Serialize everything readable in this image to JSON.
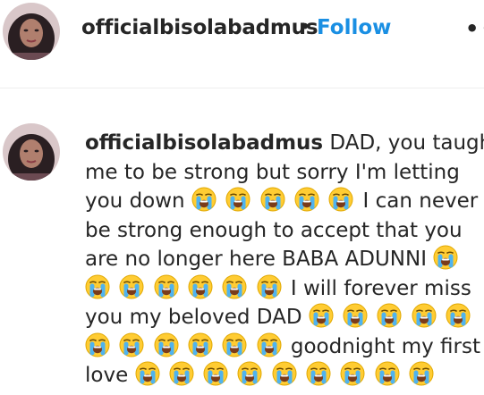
{
  "post": {
    "username": "officialbisolabadmus",
    "separator": "•",
    "follow_label": "Follow",
    "more_label": "••"
  },
  "avatar_icon": "profile-photo",
  "emoji_icon": "loudly-crying-face-emoji",
  "colors": {
    "follow": "#1a8fe3",
    "text": "#262626",
    "divider": "#efefef",
    "emoji_face": "#ffcc33",
    "emoji_tears": "#4fb3ef"
  },
  "caption": {
    "username": "officialbisolabadmus",
    "lines": [
      [
        {
          "t": "DAD, you taught"
        }
      ],
      [
        {
          "t": "me to be strong but sorry I'm letting"
        }
      ],
      [
        {
          "t": "you down "
        },
        {
          "e": 5
        },
        {
          "t": "I can never"
        }
      ],
      [
        {
          "t": "be strong enough to accept that you"
        }
      ],
      [
        {
          "t": "are no longer here BABA ADUNNI "
        },
        {
          "e": 1
        }
      ],
      [
        {
          "e": 6
        },
        {
          "t": "I will forever miss"
        }
      ],
      [
        {
          "t": "you my beloved DAD"
        },
        {
          "e": 5
        }
      ],
      [
        {
          "e": 6
        },
        {
          "t": "goodnight my first"
        }
      ],
      [
        {
          "t": "love "
        },
        {
          "e": 9
        }
      ]
    ]
  }
}
